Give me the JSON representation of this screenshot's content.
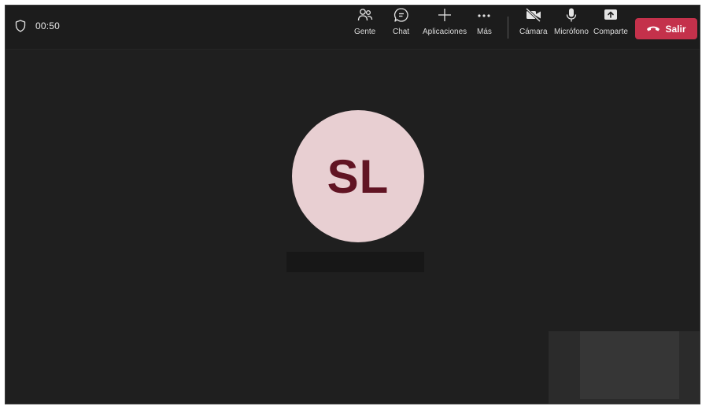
{
  "call": {
    "timer": "00:50"
  },
  "toolbar": {
    "people_label": "Gente",
    "chat_label": "Chat",
    "apps_label": "Aplicaciones",
    "more_label": "Más",
    "camera_label": "Cámara",
    "mic_label": "Micrófono",
    "share_label": "Comparte",
    "leave_label": "Salir"
  },
  "participant": {
    "initials": "SL"
  },
  "colors": {
    "background": "#1f1f1f",
    "topbar": "#1c1c1c",
    "leave_button": "#c4314b",
    "avatar_bg": "#e8cfd2",
    "avatar_text": "#611423"
  },
  "icons": {
    "shield": "shield-icon",
    "people": "people-icon",
    "chat": "chat-icon",
    "apps": "plus-icon",
    "more": "more-icon",
    "camera": "camera-off-icon",
    "mic": "microphone-icon",
    "share": "share-icon",
    "leave": "phone-hangup-icon"
  }
}
